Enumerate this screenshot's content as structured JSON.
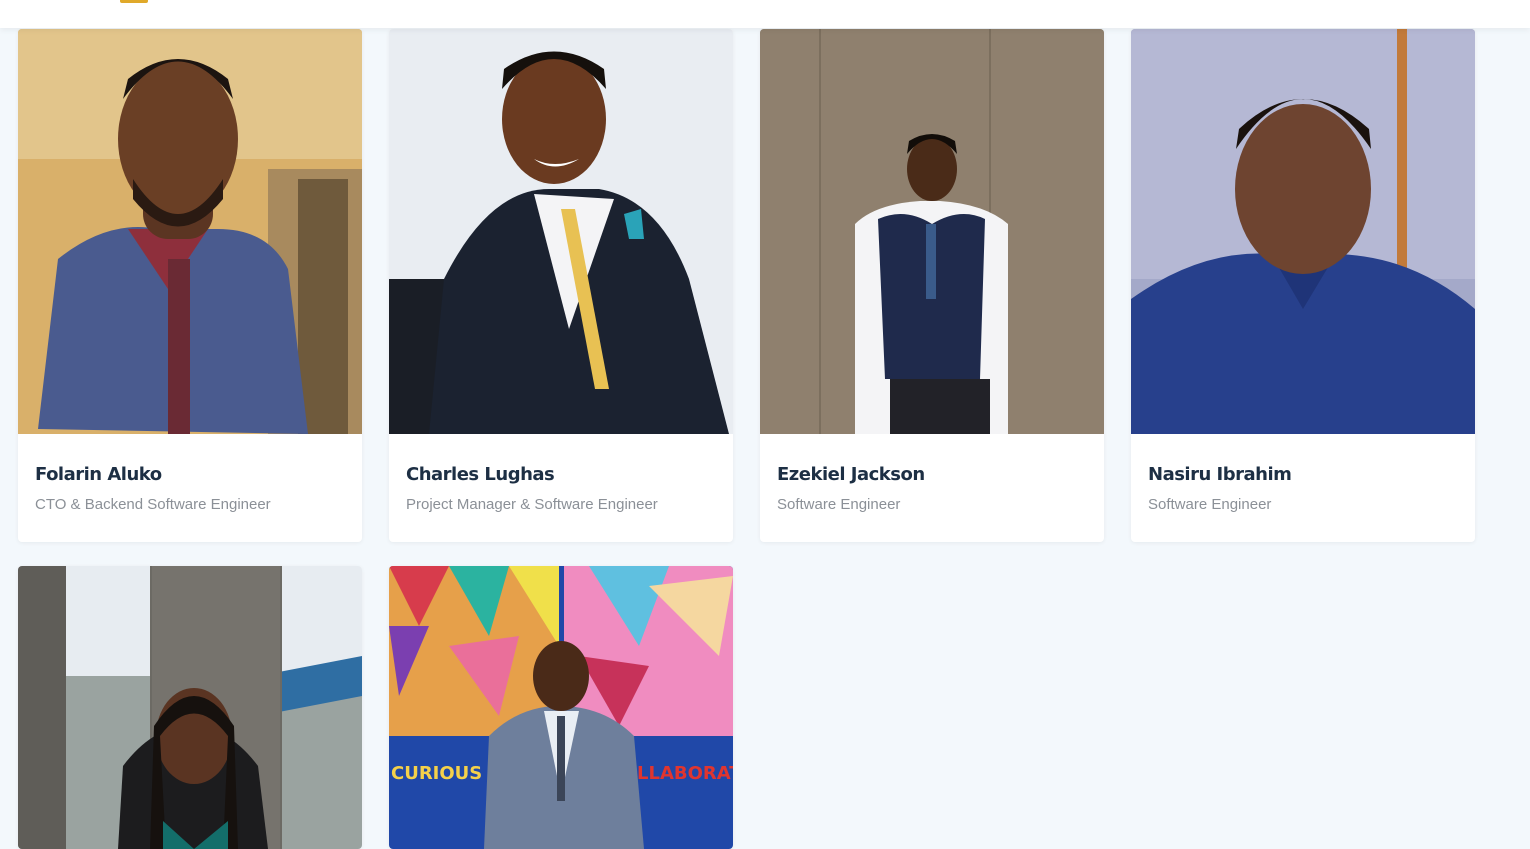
{
  "team": {
    "members": [
      {
        "name": "Folarin Aluko",
        "role": "CTO & Backend Software Engineer",
        "photo": "portrait-photo"
      },
      {
        "name": "Charles Lughas",
        "role": "Project Manager & Software Engineer",
        "photo": "portrait-photo"
      },
      {
        "name": "Ezekiel Jackson",
        "role": "Software Engineer",
        "photo": "portrait-photo"
      },
      {
        "name": "Nasiru Ibrahim",
        "role": "Software Engineer",
        "photo": "portrait-photo"
      },
      {
        "name": "",
        "role": "",
        "photo": "portrait-photo"
      },
      {
        "name": "",
        "role": "",
        "photo": "portrait-photo"
      }
    ],
    "mural_texts": [
      "CURIOUS",
      "LLABORAT"
    ]
  },
  "colors": {
    "background": "#f3f8fc",
    "card": "#ffffff",
    "name_text": "#1d2f44",
    "role_text": "#8b9097",
    "accent": "#e0a92a"
  }
}
